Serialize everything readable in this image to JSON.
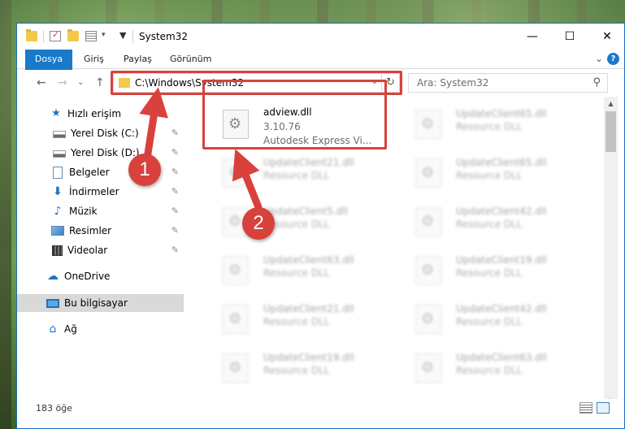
{
  "window": {
    "title": "System32",
    "controls": {
      "minimize": "—",
      "maximize": "☐",
      "close": "✕"
    }
  },
  "ribbon": {
    "tabs": [
      "Dosya",
      "Giriş",
      "Paylaş",
      "Görünüm"
    ],
    "expand": "⌄",
    "help": "?"
  },
  "nav": {
    "back": "←",
    "forward": "→",
    "recent": "⌄",
    "up": "↑",
    "address": "C:\\Windows\\System32",
    "address_dropdown": "⌄",
    "refresh": "↻",
    "search_placeholder": "Ara: System32",
    "search_icon": "search-icon"
  },
  "sidebar": {
    "items": [
      {
        "label": "Hızlı erişim",
        "icon": "star-icon"
      },
      {
        "label": "Yerel Disk (C:)",
        "icon": "drive-icon",
        "pinned": true
      },
      {
        "label": "Yerel Disk (D:)",
        "icon": "drive-icon",
        "pinned": true
      },
      {
        "label": "Belgeler",
        "icon": "document-icon",
        "pinned": true
      },
      {
        "label": "İndirmeler",
        "icon": "download-icon",
        "pinned": true
      },
      {
        "label": "Müzik",
        "icon": "music-icon",
        "pinned": true
      },
      {
        "label": "Resimler",
        "icon": "pictures-icon",
        "pinned": true
      },
      {
        "label": "Videolar",
        "icon": "video-icon",
        "pinned": true
      },
      {
        "label": "OneDrive",
        "icon": "cloud-icon"
      },
      {
        "label": "Bu bilgisayar",
        "icon": "computer-icon",
        "selected": true
      },
      {
        "label": "Ağ",
        "icon": "network-icon"
      }
    ],
    "pin_glyph": "📌"
  },
  "files": {
    "highlighted": {
      "name": "adview.dll",
      "version": "3.10.76",
      "description": "Autodesk Express Vi..."
    },
    "others": [
      {
        "name": "UpdateClient65.dll",
        "type": "Resource DLL"
      },
      {
        "name": "UpdateClient21.dll",
        "type": "Resource DLL"
      },
      {
        "name": "UpdateClient65.dll",
        "type": "Resource DLL"
      },
      {
        "name": "UpdateClient5.dll",
        "type": "Resource DLL"
      },
      {
        "name": "UpdateClient42.dll",
        "type": "Resource DLL"
      },
      {
        "name": "UpdateClient63.dll",
        "type": "Resource DLL"
      },
      {
        "name": "UpdateClient19.dll",
        "type": "Resource DLL"
      },
      {
        "name": "UpdateClient21.dll",
        "type": "Resource DLL"
      },
      {
        "name": "UpdateClient42.dll",
        "type": "Resource DLL"
      },
      {
        "name": "UpdateClient19.dll",
        "type": "Resource DLL"
      },
      {
        "name": "UpdateClient63.dll",
        "type": "Resource DLL"
      }
    ]
  },
  "scrollbar": {
    "up": "▲",
    "down": "▼"
  },
  "status": {
    "count": "183 öğe"
  },
  "callouts": {
    "one": "1",
    "two": "2"
  },
  "colors": {
    "accent": "#1979ca",
    "callout": "#d9413c",
    "folder": "#f3c94c"
  }
}
